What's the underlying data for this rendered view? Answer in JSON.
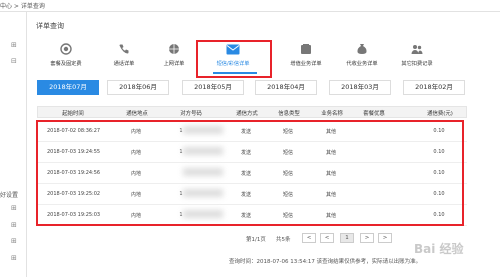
{
  "breadcrumb": "中心 > 详单查询",
  "leftnav": {
    "label": "好设置"
  },
  "section_title": "详单查询",
  "categories": [
    {
      "label": "套餐及固定费",
      "icon": "circle-icon",
      "active": false
    },
    {
      "label": "通话详单",
      "icon": "phone-icon",
      "active": false
    },
    {
      "label": "上网详单",
      "icon": "globe-icon",
      "active": false
    },
    {
      "label": "短信/彩信详单",
      "icon": "mail-icon",
      "active": true
    },
    {
      "label": "增值业务详单",
      "icon": "app-box-icon",
      "active": false
    },
    {
      "label": "代收业务详单",
      "icon": "money-bag-icon",
      "active": false
    },
    {
      "label": "其它扣费记录",
      "icon": "people-icon",
      "active": false
    }
  ],
  "months": [
    {
      "label": "2018年07月",
      "active": true
    },
    {
      "label": "2018年06月",
      "active": false
    },
    {
      "label": "2018年05月",
      "active": false
    },
    {
      "label": "2018年04月",
      "active": false
    },
    {
      "label": "2018年03月",
      "active": false
    },
    {
      "label": "2018年02月",
      "active": false
    }
  ],
  "table": {
    "columns": [
      "起始时间",
      "通信地点",
      "对方号码",
      "通信方式",
      "信息类型",
      "业务名称",
      "套餐优惠",
      "通信费(元)"
    ],
    "rows": [
      [
        "2018-07-02 08:36:27",
        "内地",
        "1",
        "发送",
        "短信",
        "其他",
        "",
        "0.10"
      ],
      [
        "2018-07-03 19:24:55",
        "内地",
        "1",
        "发送",
        "短信",
        "其他",
        "",
        "0.10"
      ],
      [
        "2018-07-03 19:24:56",
        "内地",
        "",
        "发送",
        "短信",
        "其他",
        "",
        "0.10"
      ],
      [
        "2018-07-03 19:25:02",
        "内地",
        "1",
        "发送",
        "短信",
        "其他",
        "",
        "0.10"
      ],
      [
        "2018-07-03 19:25:03",
        "内地",
        "1",
        "发送",
        "短信",
        "其他",
        "",
        "0.10"
      ]
    ]
  },
  "pager": {
    "page_info": "第1/1页",
    "total": "共5条",
    "current": "1",
    "prev": "<",
    "next": ">"
  },
  "footnote": "查询时间：2018-07-06 13:54:17 该查询结果仅供参考，实际请以出账为准。",
  "watermark": "Bai 经验",
  "colors": {
    "accent": "#2a8ae3",
    "highlight": "#e8232a"
  }
}
